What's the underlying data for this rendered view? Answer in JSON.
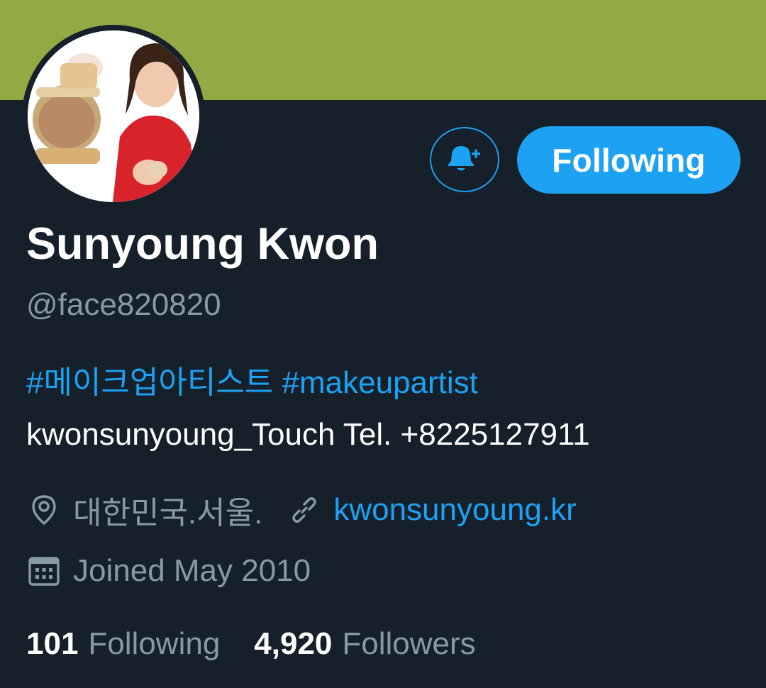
{
  "banner": {
    "color": "#92a944"
  },
  "profile": {
    "display_name": "Sunyoung Kwon",
    "handle": "@face820820",
    "bio": {
      "hashtag_1": "#메이크업아티스트",
      "hashtag_2": "#makeupartist",
      "line_2": "kwonsunyoung_Touch Tel. +8225127911"
    },
    "location": "대한민국.서울.",
    "website": "kwonsunyoung.kr",
    "joined": "Joined May 2010"
  },
  "actions": {
    "notify_icon": "bell-plus-icon",
    "follow_label": "Following"
  },
  "stats": {
    "following_count": "101",
    "following_label": "Following",
    "followers_count": "4,920",
    "followers_label": "Followers"
  },
  "colors": {
    "background": "#15202b",
    "accent": "#1da1f2",
    "secondary_text": "#8899a6",
    "primary_text": "#ffffff"
  },
  "icons": {
    "location": "location-pin-icon",
    "link": "link-icon",
    "calendar": "calendar-icon"
  }
}
